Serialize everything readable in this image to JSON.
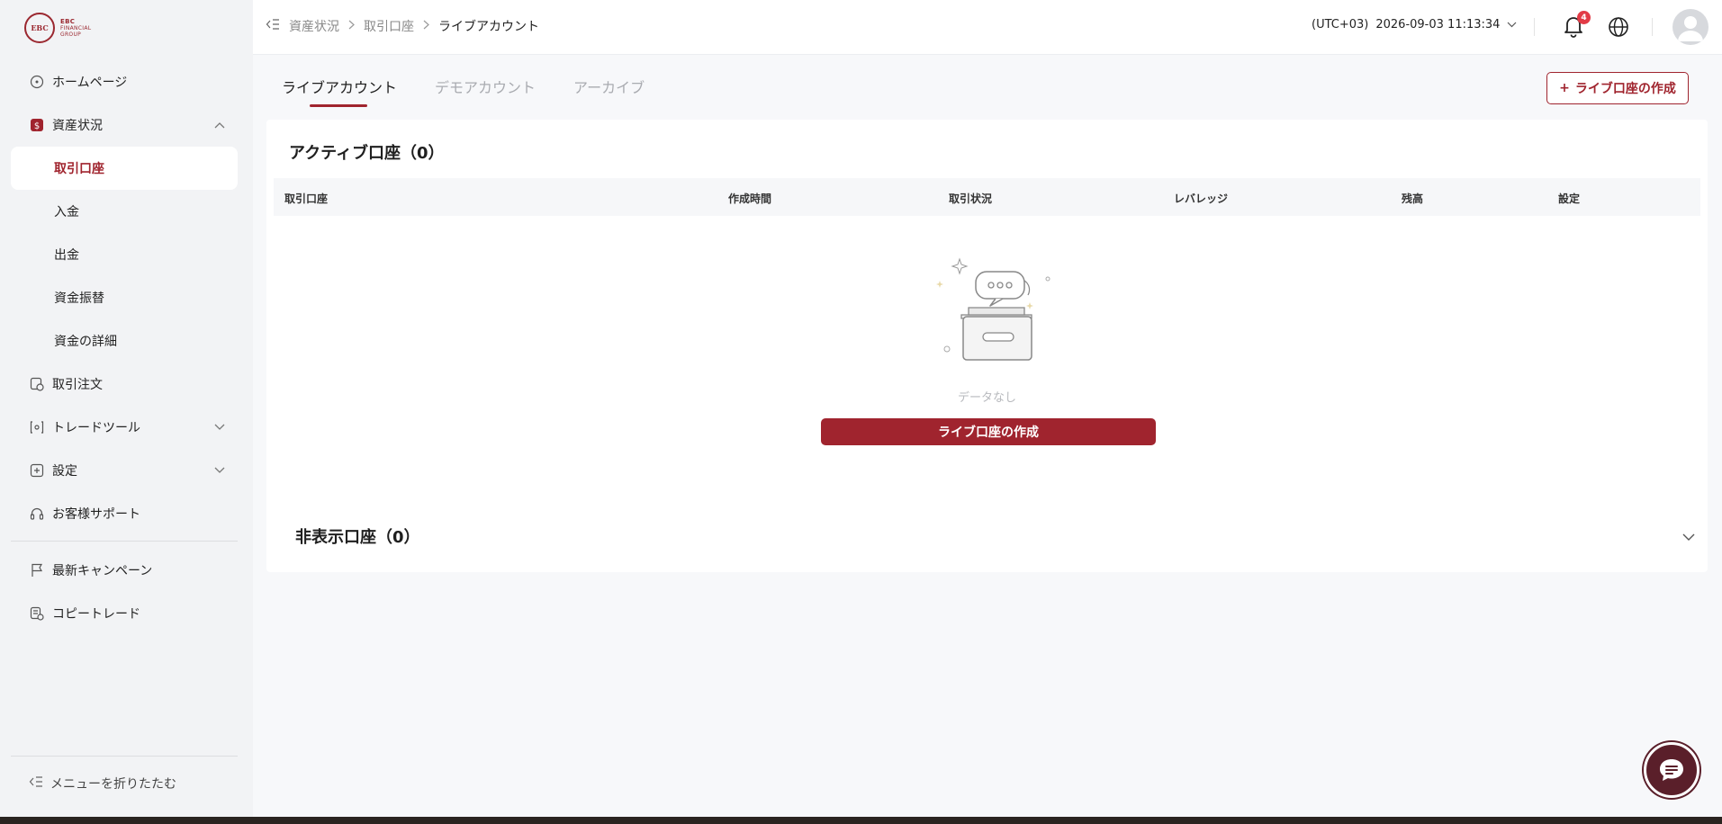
{
  "logo": {
    "mark": "EBC",
    "line1": "EBC",
    "line2": "FINANCIAL",
    "line3": "GROUP"
  },
  "sidebar": {
    "items": [
      {
        "label": "ホームページ",
        "icon": "home-icon"
      },
      {
        "label": "資産状況",
        "icon": "asset-icon"
      },
      {
        "label": "取引口座"
      },
      {
        "label": "入金"
      },
      {
        "label": "出金"
      },
      {
        "label": "資金振替"
      },
      {
        "label": "資金の詳細"
      },
      {
        "label": "取引注文",
        "icon": "order-icon"
      },
      {
        "label": "トレードツール",
        "icon": "tools-icon"
      },
      {
        "label": "設定",
        "icon": "settings-icon"
      },
      {
        "label": "お客様サポート",
        "icon": "headset-icon"
      },
      {
        "label": "最新キャンペーン",
        "icon": "flag-icon"
      },
      {
        "label": "コピートレード",
        "icon": "copy-icon"
      }
    ],
    "collapse_label": "メニューを折りたたむ"
  },
  "header": {
    "breadcrumb": [
      "資産状況",
      "取引口座",
      "ライブアカウント"
    ],
    "timezone": "(UTC+03)",
    "datetime": "2026-09-03 11:13:34",
    "notification_count": "4"
  },
  "tabs": [
    "ライブアカウント",
    "デモアカウント",
    "アーカイブ"
  ],
  "create_button": "ライブ口座の作成",
  "active_section": {
    "title": "アクティブ口座（0）",
    "columns": [
      "取引口座",
      "作成時間",
      "取引状況",
      "レバレッジ",
      "残高",
      "設定"
    ],
    "empty_text": "データなし",
    "create_label": "ライブ口座の作成"
  },
  "hidden_section": {
    "title": "非表示口座（0）"
  },
  "colors": {
    "accent": "#a0242e",
    "chat": "#5a1f2a"
  }
}
